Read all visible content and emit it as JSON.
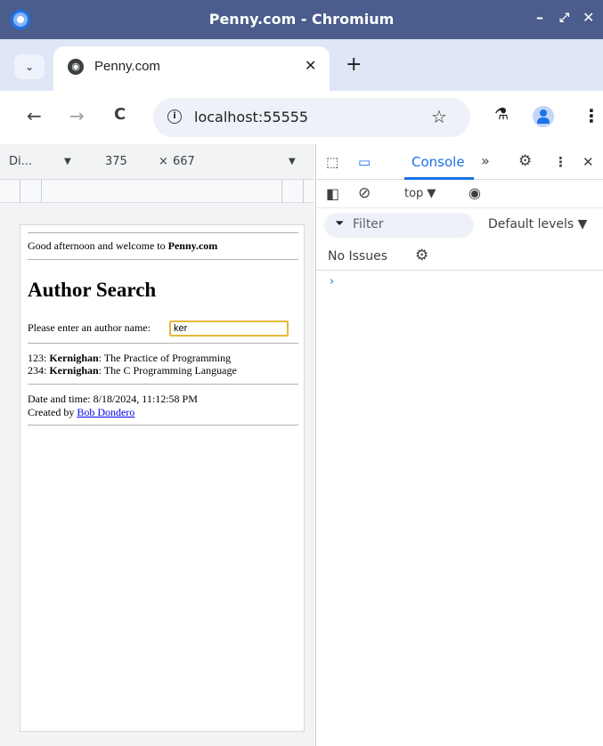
{
  "window": {
    "title": "Penny.com - Chromium",
    "controls": {
      "minimize": "–",
      "maximize": "⤢",
      "close": "✕"
    }
  },
  "tabs": {
    "dropdown_icon": "⌄",
    "active_tab": {
      "title": "Penny.com",
      "close": "✕"
    },
    "new_tab": "+"
  },
  "toolbar": {
    "back": "←",
    "forward": "→",
    "reload": "C",
    "url": "localhost:55555",
    "bookmark": "☆",
    "labs": "⚗",
    "menu": "⋮"
  },
  "device_toolbar": {
    "device": "Di...",
    "device_arrow": "▼",
    "width": "375",
    "times": "×",
    "height": "667",
    "zoom_arrow": "▼"
  },
  "page": {
    "greeting_prefix": "Good afternoon and welcome to ",
    "greeting_site": "Penny.com",
    "heading": "Author Search",
    "prompt_label": "Please enter an author name:",
    "input_value": "ker",
    "results": [
      {
        "id": "123:",
        "author": "Kernighan",
        "title": ": The Practice of Programming"
      },
      {
        "id": "234:",
        "author": "Kernighan",
        "title": ": The C Programming Language"
      }
    ],
    "datetime": "Date and time: 8/18/2024, 11:12:58 PM",
    "created_prefix": "Created by ",
    "created_link": "Bob Dondero"
  },
  "devtools": {
    "inspect_icon": "⬚",
    "device_icon": "▭",
    "console_tab": "Console",
    "more_tabs": "»",
    "settings_icon": "⚙",
    "kebab": "⋮",
    "close": "✕",
    "sidebar_icon": "◧",
    "clear_icon": "⊘",
    "context": "top ▼",
    "eye_icon": "◉",
    "filter_icon": "⏷",
    "filter_placeholder": "Filter",
    "levels": "Default levels ▼",
    "issues": "No Issues",
    "issues_settings_icon": "⚙",
    "prompt_symbol": "›"
  }
}
